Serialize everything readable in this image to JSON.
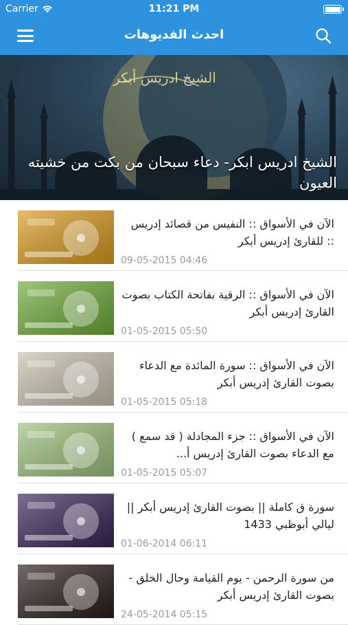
{
  "status_bar": {
    "carrier": "Carrier",
    "time": "11:21 PM",
    "battery_level": 1.0
  },
  "nav": {
    "title": "احدث الفديوهات",
    "menu_icon": "hamburger-menu-icon",
    "search_icon": "search-icon",
    "background_color": "#2f92df"
  },
  "hero": {
    "image_text": "الشيخ ادريس أبكر",
    "caption": "الشيخ ادريس ابكر- دعاء سبحان من بكت من خشيته العيون"
  },
  "videos": [
    {
      "title": "الآن في الأسواق :: النفيس من قصائد إدريس :: للقارئ إدريس أبكر",
      "date": "09-05-2015 04:46",
      "thumb_color": "#d99a1e"
    },
    {
      "title": "الآن في الأسواق :: الرقية بفاتحة الكتاب بصوت القارئ إدريس أبكر",
      "date": "01-05-2015 05:50",
      "thumb_color": "#6eaa3a"
    },
    {
      "title": "الآن في الأسواق :: سورة المائدة مع الدعاء بصوت القارئ إدريس أبكر",
      "date": "01-05-2015 05:18",
      "thumb_color": "#c6c0ad"
    },
    {
      "title": "الآن في الأسواق :: جزء المجادلة ( قد سمع ) مع الدعاء بصوت القارئ إدريس أ...",
      "date": "01-05-2015 05:07",
      "thumb_color": "#9bc07a"
    },
    {
      "title": "سورة ق كاملة || بصوت القارئ إدريس أبكر || ليالي أبوظبي 1433",
      "date": "01-06-2014 06:11",
      "thumb_color": "#3a2458"
    },
    {
      "title": "من سورة الرحمن - يوم القيامة وحال الخلق - بصوت القارئ إدريس أبكر",
      "date": "24-05-2014 05:15",
      "thumb_color": "#2a1c18"
    }
  ]
}
